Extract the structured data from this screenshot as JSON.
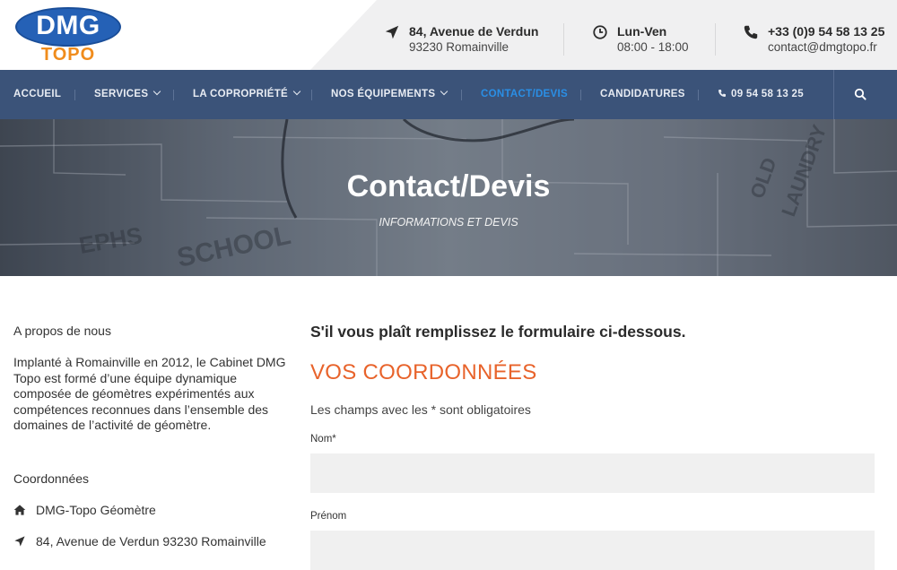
{
  "brand": {
    "logo_main": "DMG",
    "logo_sub": "TOPO"
  },
  "header": {
    "address": {
      "icon": "location-arrow-icon",
      "title": "84, Avenue de Verdun",
      "sub": "93230 Romainville"
    },
    "hours": {
      "icon": "clock-icon",
      "title": "Lun-Ven",
      "sub": "08:00 - 18:00"
    },
    "contact": {
      "icon": "phone-icon",
      "title": "+33 (0)9 54 58 13 25",
      "sub": "contact@dmgtopo.fr"
    }
  },
  "nav": {
    "items": [
      {
        "label": "ACCUEIL",
        "dropdown": false,
        "active": false
      },
      {
        "label": "SERVICES",
        "dropdown": true,
        "active": false
      },
      {
        "label": "LA COPROPRIÉTÉ",
        "dropdown": true,
        "active": false
      },
      {
        "label": "NOS ÉQUIPEMENTS",
        "dropdown": true,
        "active": false
      },
      {
        "label": "CONTACT/DEVIS",
        "dropdown": false,
        "active": true
      },
      {
        "label": "CANDIDATURES",
        "dropdown": false,
        "active": false
      }
    ],
    "phone": "09 54 58 13 25",
    "search_icon": "search-icon",
    "active_color": "#2a8fe6",
    "background": "#3b5379"
  },
  "hero": {
    "title": "Contact/Devis",
    "subtitle": "INFORMATIONS ET DEVIS"
  },
  "sidebar": {
    "about_title": "A propos de nous",
    "about_text": "Implanté à Romainville en 2012, le Cabinet DMG Topo est formé d’une équipe dynamique composée de géomètres expérimentés aux compétences reconnues dans l’ensemble des domaines de l’activité de géomètre.",
    "contact_title": "Coordonnées",
    "contact_items": [
      {
        "icon": "home-icon",
        "text": "DMG-Topo Géomètre"
      },
      {
        "icon": "location-arrow-icon",
        "text": "84, Avenue de Verdun 93230 Romainville"
      }
    ]
  },
  "form": {
    "intro": "S'il vous plaît remplissez le formulaire ci-dessous.",
    "heading": "VOS COORDONNÉES",
    "heading_color": "#e8632b",
    "required_note": "Les champs avec les * sont obligatoires",
    "fields": [
      {
        "label": "Nom*",
        "value": "",
        "placeholder": ""
      },
      {
        "label": "Prénom",
        "value": "",
        "placeholder": ""
      }
    ]
  }
}
